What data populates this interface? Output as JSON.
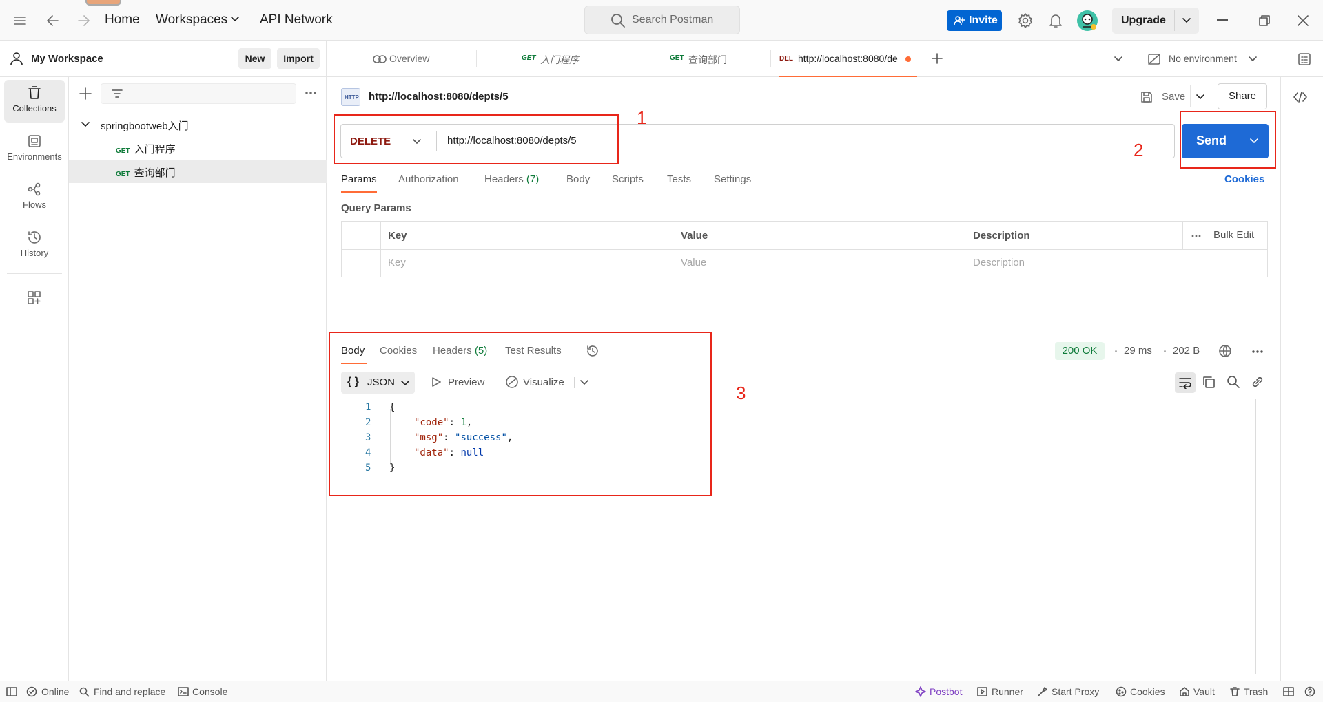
{
  "topbar": {
    "home": "Home",
    "workspaces": "Workspaces",
    "api_network": "API Network",
    "search_placeholder": "Search Postman",
    "invite": "Invite",
    "upgrade": "Upgrade"
  },
  "workspace": {
    "name": "My Workspace",
    "new_label": "New",
    "import_label": "Import"
  },
  "rail": [
    {
      "label": "Collections",
      "icon": "trash-can-collections-icon"
    },
    {
      "label": "Environments",
      "icon": "environment-icon"
    },
    {
      "label": "Flows",
      "icon": "flows-icon"
    },
    {
      "label": "History",
      "icon": "history-icon"
    }
  ],
  "collections": {
    "name": "springbootweb入门",
    "items": [
      {
        "method": "GET",
        "label": "入门程序"
      },
      {
        "method": "GET",
        "label": "查询部门"
      }
    ]
  },
  "tabs": {
    "overview": "Overview",
    "tab1_method": "GET",
    "tab1_label": "入门程序",
    "tab2_method": "GET",
    "tab2_label": "查询部门",
    "tab3_method": "DEL",
    "tab3_label": "http://localhost:8080/de",
    "environment": "No environment"
  },
  "request": {
    "title": "http://localhost:8080/depts/5",
    "save": "Save",
    "share": "Share",
    "method": "DELETE",
    "url": "http://localhost:8080/depts/5",
    "send": "Send",
    "annotation_1": "1",
    "annotation_2": "2",
    "annotation_3": "3",
    "tabs": [
      "Params",
      "Authorization",
      "Headers",
      "Body",
      "Scripts",
      "Tests",
      "Settings"
    ],
    "headers_count": "(7)",
    "cookies": "Cookies",
    "query_params": "Query Params",
    "table_headers": [
      "Key",
      "Value",
      "Description"
    ],
    "bulk_edit": "Bulk Edit",
    "placeholders": [
      "Key",
      "Value",
      "Description"
    ]
  },
  "response": {
    "tabs": [
      "Body",
      "Cookies",
      "Headers",
      "Test Results"
    ],
    "headers_count": "(5)",
    "status": "200 OK",
    "time": "29 ms",
    "size": "202 B",
    "format": "JSON",
    "preview": "Preview",
    "visualize": "Visualize",
    "lines": [
      {
        "n": "1",
        "text": "{"
      },
      {
        "n": "2",
        "key": "\"code\"",
        "val": "1",
        "vtype": "num",
        "comma": ","
      },
      {
        "n": "3",
        "key": "\"msg\"",
        "val": "\"success\"",
        "vtype": "str",
        "comma": ","
      },
      {
        "n": "4",
        "key": "\"data\"",
        "val": "null",
        "vtype": "null",
        "comma": ""
      },
      {
        "n": "5",
        "text": "}"
      }
    ]
  },
  "statusbar": {
    "online": "Online",
    "find_replace": "Find and replace",
    "console": "Console",
    "postbot": "Postbot",
    "runner": "Runner",
    "start_proxy": "Start Proxy",
    "cookies": "Cookies",
    "vault": "Vault",
    "trash": "Trash"
  },
  "colors": {
    "accent": "#0265d2",
    "send": "#1e6ad6",
    "highlight_box": "#e8261a",
    "active_tab": "#ff6c37",
    "status_ok": "#0f7b3a",
    "delete_method": "#8e1a10"
  }
}
